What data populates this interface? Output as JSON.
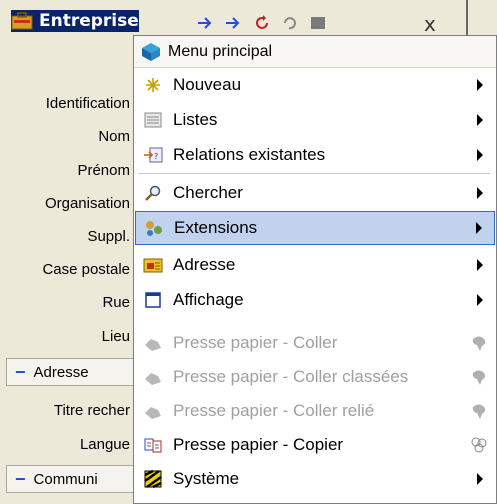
{
  "window": {
    "title": "Entreprise",
    "close_glyph": "x"
  },
  "form": {
    "labels": [
      "Identification",
      "Nom",
      "Prénom",
      "Organisation",
      "Suppl.",
      "Case postale",
      "Rue",
      "Lieu",
      "Titre recher",
      "Langue"
    ],
    "sections": [
      {
        "label": "Adresse"
      },
      {
        "label": "Communi"
      }
    ]
  },
  "menu": {
    "header": "Menu principal",
    "items": [
      {
        "label": "Nouveau",
        "icon": "new-icon",
        "submenu": true,
        "enabled": true
      },
      {
        "label": "Listes",
        "icon": "list-icon",
        "submenu": true,
        "enabled": true
      },
      {
        "label": "Relations existantes",
        "icon": "relations-icon",
        "submenu": true,
        "enabled": true
      },
      {
        "label": "Chercher",
        "icon": "search-icon",
        "submenu": true,
        "enabled": true
      },
      {
        "label": "Extensions",
        "icon": "extensions-icon",
        "submenu": true,
        "enabled": true,
        "highlighted": true
      },
      {
        "label": "Adresse",
        "icon": "address-icon",
        "submenu": true,
        "enabled": true
      },
      {
        "label": "Affichage",
        "icon": "display-icon",
        "submenu": true,
        "enabled": true
      },
      {
        "label": "Presse papier - Coller",
        "icon": "paste-icon",
        "submenu": false,
        "enabled": false
      },
      {
        "label": "Presse papier - Coller classées",
        "icon": "paste-classified-icon",
        "submenu": false,
        "enabled": false
      },
      {
        "label": "Presse papier - Coller relié",
        "icon": "paste-linked-icon",
        "submenu": false,
        "enabled": false
      },
      {
        "label": "Presse papier - Copier",
        "icon": "copy-icon",
        "submenu": false,
        "enabled": true
      },
      {
        "label": "Système",
        "icon": "system-icon",
        "submenu": true,
        "enabled": true
      }
    ]
  },
  "colors": {
    "title_bg": "#0a246a",
    "highlight_bg": "#c1d2ee",
    "highlight_border": "#316ac5",
    "disabled_text": "#a0a0a0"
  }
}
